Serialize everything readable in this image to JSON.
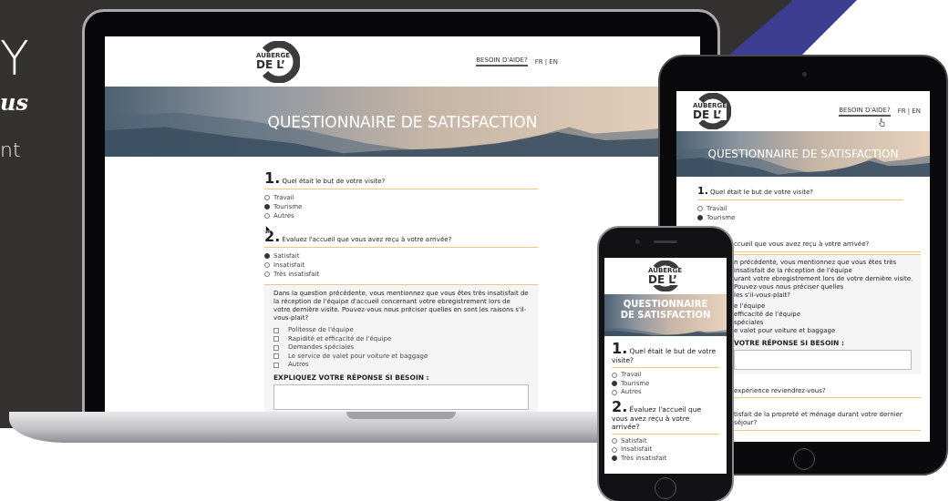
{
  "backdrop_text": [
    {
      "text": "Y",
      "kind": "large"
    },
    {
      "text": "us",
      "kind": "script"
    },
    {
      "text": "nt",
      "kind": "light"
    }
  ],
  "laptop": {
    "logo": [
      "AUBERGE",
      "DE L’"
    ],
    "help_link": "BESOIN D'AIDE?",
    "language": "FR | EN",
    "banner_title": "QUESTIONNAIRE DE SATISFACTION",
    "questions": [
      {
        "number": "1.",
        "text": "Quel était le but de votre visite?",
        "options": [
          {
            "label": "Travail",
            "selected": false
          },
          {
            "label": "Tourisme",
            "selected": true
          },
          {
            "label": "Autres",
            "selected": false
          }
        ]
      },
      {
        "number": "2.",
        "text": "Évaluez l'accueil que vous avez reçu à votre arrivée?",
        "options": [
          {
            "label": "Satisfait",
            "selected": true
          },
          {
            "label": "Insatisfait",
            "selected": false
          },
          {
            "label": "Très insatisfait",
            "selected": false
          }
        ]
      }
    ],
    "followup": {
      "text": "Dans la question précédente, vous mentionnez que vous êtes très insatisfait de la réception de l'équipe d'accueil concernant votre ebregistrement lors de votre dernière visite. Pouvez-vous nous préciser quelles en sont les raisons s'il-vous-plait?",
      "checkboxes": [
        {
          "label": "Politesse de l'équipe",
          "checked": false
        },
        {
          "label": "Rapidité et efficacité de l'équipe",
          "checked": false
        },
        {
          "label": "Demandes spéciales",
          "checked": false
        },
        {
          "label": "Le service de valet pour voiture et baggage",
          "checked": false
        },
        {
          "label": "Autres",
          "checked": false
        }
      ],
      "explain_label": "EXPLIQUEZ VOTRE RÉPONSE SI BESOIN :"
    }
  },
  "tablet": {
    "logo": [
      "AUBERGE",
      "DE L’"
    ],
    "help_link": "BESOIN D'AIDE?",
    "language": "FR | EN",
    "banner_title": "QUESTIONNAIRE DE SATISFACTION",
    "questions": [
      {
        "number": "1.",
        "text": "Quel était le but de votre visite?",
        "options": [
          {
            "label": "Travail",
            "selected": false
          },
          {
            "label": "Tourisme",
            "selected": true
          }
        ]
      }
    ],
    "cut_heading": "ccueil que vous avez reçu à votre arrivée?",
    "panel": {
      "lines": [
        "n précédente, vous mentionnez que vous êtes très insatisfait de la réception de l'équipe",
        "urant votre ebregistrement lors de votre dernière visite. Pouvez-vous nous préciser quelles",
        "les s'il-vous-plait?"
      ],
      "items": [
        "e l'équipe",
        "efficacité de l'équipe",
        "spéciales",
        "e valet pour voiture et baggage"
      ],
      "explain_label": "VOTRE RÉPONSE SI BESOIN :"
    },
    "more_headings": [
      "expérience reviendrez-vous?",
      "tisfait de la propreté et ménage durant votre dernier séjour?"
    ]
  },
  "phone": {
    "logo": [
      "AUBERGE",
      "DE L’"
    ],
    "banner_title": "QUESTIONNAIRE DE SATISFACTION",
    "questions": [
      {
        "number": "1.",
        "text": "Quel était le but de votre visite?",
        "options": [
          {
            "label": "Travail",
            "selected": false
          },
          {
            "label": "Tourisme",
            "selected": true
          },
          {
            "label": "Autres",
            "selected": false
          }
        ]
      },
      {
        "number": "2.",
        "text": "Évaluez l'accueil que vous avez reçu à votre arrivée?",
        "options": [
          {
            "label": "Satisfait",
            "selected": false
          },
          {
            "label": "Insatisfait",
            "selected": false
          },
          {
            "label": "Très insatisfait",
            "selected": true
          }
        ]
      }
    ]
  }
}
